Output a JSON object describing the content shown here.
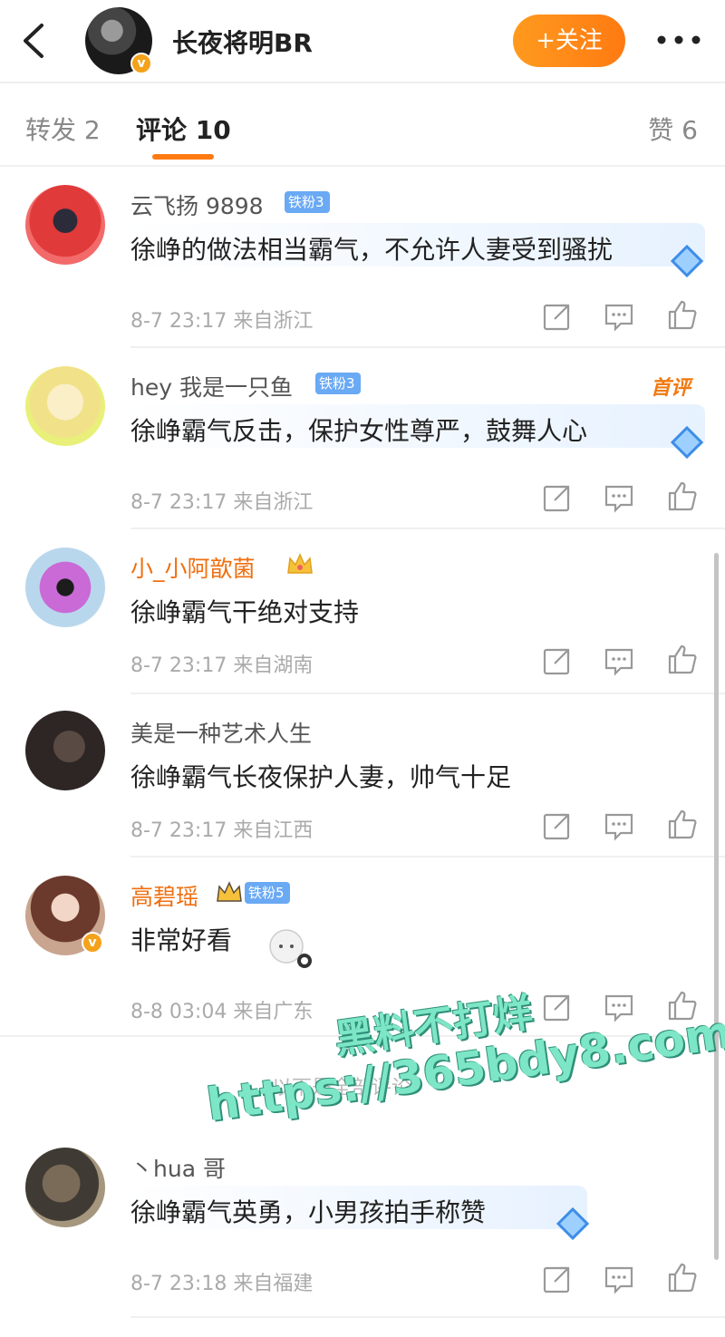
{
  "header": {
    "title": "长夜将明BR",
    "follow_label": "+关注",
    "verified_mark": "v",
    "colors": {
      "follow": "#ff8a18",
      "verified": "#f4a21b"
    }
  },
  "tabs": {
    "repost": "转发 2",
    "comments": "评论 10",
    "likes": "赞 6"
  },
  "comments": [
    {
      "name": "云飞扬 9898",
      "badge": "铁粉3",
      "text": "徐峥的做法相当霸气，不允许人妻受到骚扰",
      "time": "8-7 23:17",
      "location": "来自浙江"
    },
    {
      "name": "hey 我是一只鱼",
      "badge": "铁粉3",
      "tag": "首评",
      "text": "徐峥霸气反击，保护女性尊严，鼓舞人心",
      "time": "8-7 23:17",
      "location": "来自浙江"
    },
    {
      "name": "小_小阿歆菌",
      "text": "徐峥霸气干绝对支持",
      "time": "8-7 23:17",
      "location": "来自湖南"
    },
    {
      "name": "美是一种艺术人生",
      "text": "徐峥霸气长夜保护人妻，帅气十足",
      "time": "8-7 23:17",
      "location": "来自江西"
    },
    {
      "name": "高碧瑶",
      "badge": "铁粉5",
      "text": "非常好看",
      "time": "8-8 03:04",
      "location": "来自广东"
    },
    {
      "name": "丶hua 哥",
      "text": "徐峥霸气英勇，小男孩拍手称赞",
      "time": "8-7 23:18",
      "location": "来自福建"
    }
  ],
  "section_label": "以下是全部评论",
  "watermark": {
    "line1": "黑料不打烊",
    "line2": "https://365bdy8.com"
  }
}
